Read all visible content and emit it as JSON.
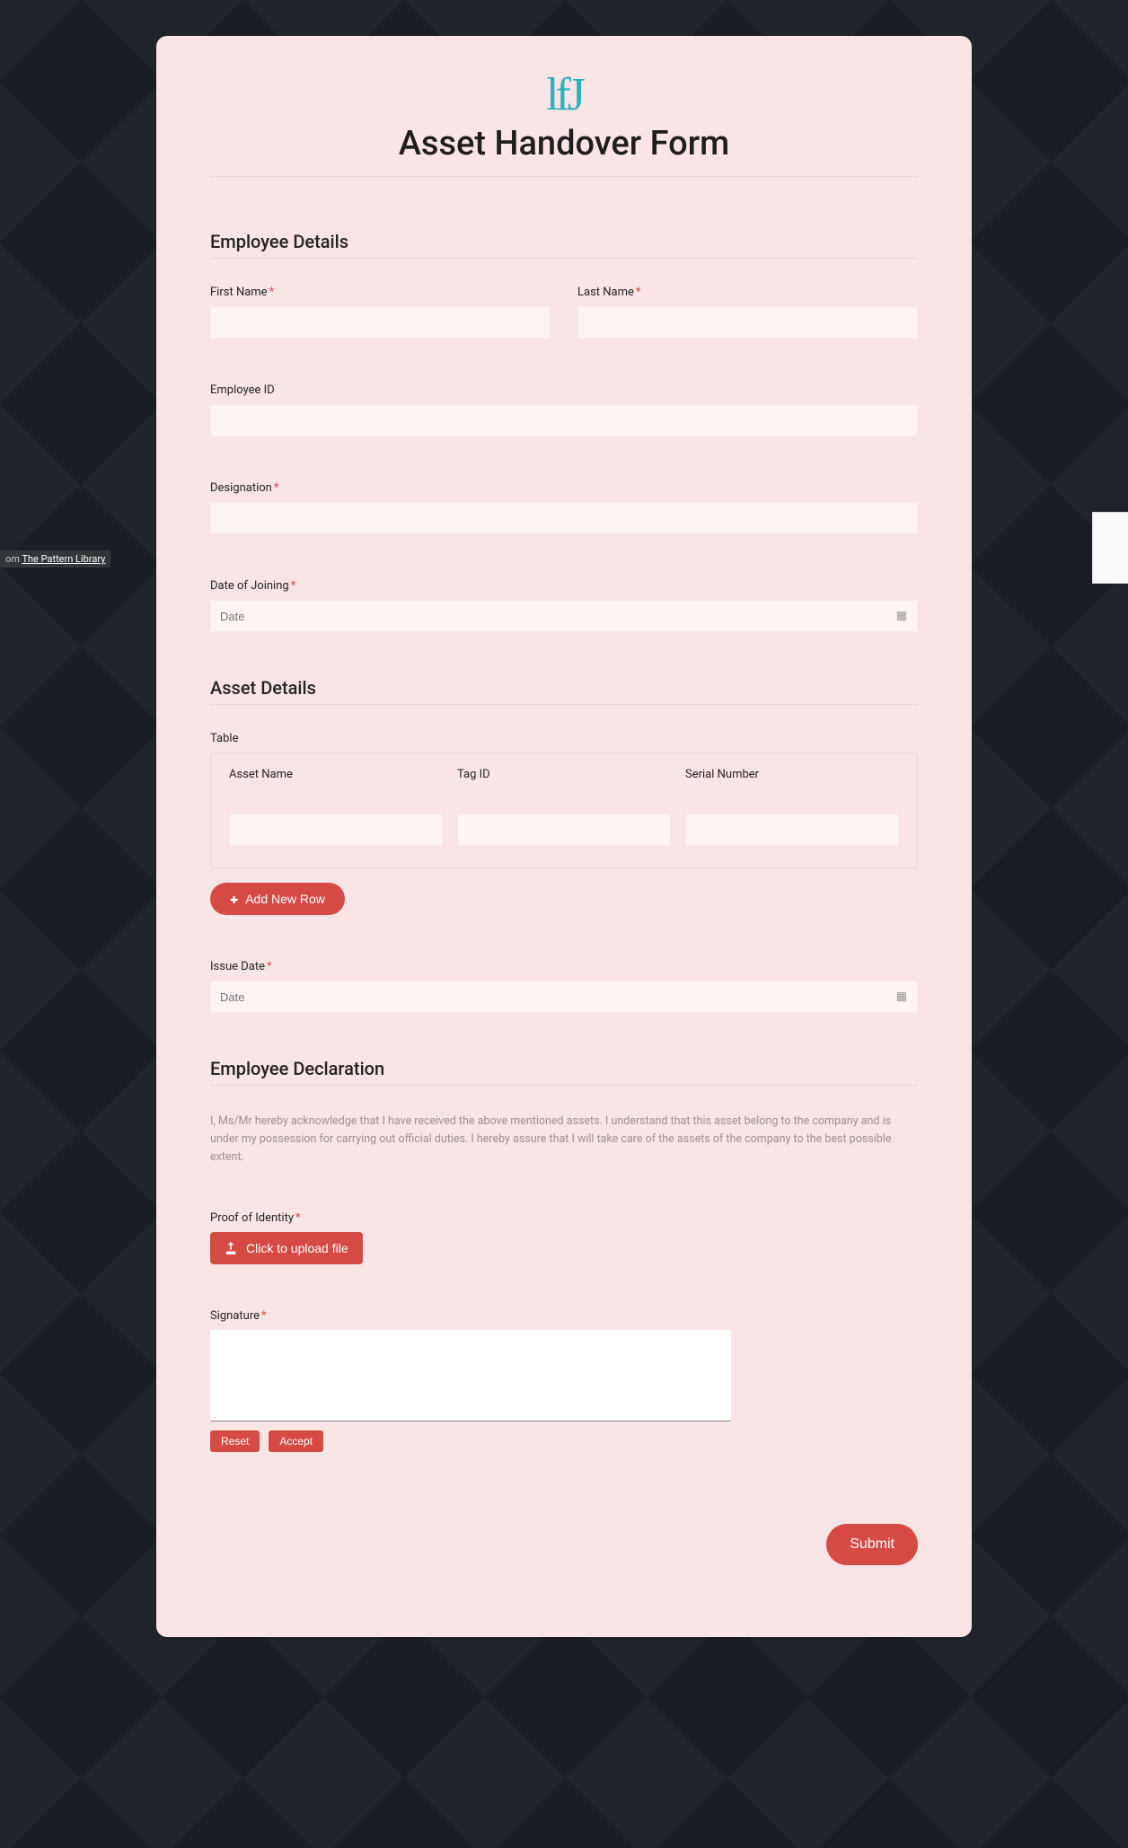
{
  "attribution": {
    "prefix": "om ",
    "link": "The Pattern Library"
  },
  "header": {
    "logo_text": "lfJ",
    "title": "Asset Handover Form"
  },
  "sections": {
    "employee": {
      "title": "Employee Details",
      "first_name_label": "First Name",
      "last_name_label": "Last Name",
      "employee_id_label": "Employee ID",
      "designation_label": "Designation",
      "doj_label": "Date of Joining",
      "date_placeholder": "Date"
    },
    "assets": {
      "title": "Asset Details",
      "table_label": "Table",
      "col1": "Asset Name",
      "col2": "Tag ID",
      "col3": "Serial Number",
      "add_row": "Add New Row",
      "issue_date_label": "Issue Date",
      "date_placeholder": "Date"
    },
    "declaration": {
      "title": "Employee Declaration",
      "text": "I, Ms/Mr hereby acknowledge that I have received the above mentioned assets. I understand that this asset belong to the company and is under my possession for carrying out official duties. I hereby assure that I will take care of the assets of the company to the best possible extent.",
      "proof_label": "Proof of Identity",
      "upload_label": "Click to upload file",
      "signature_label": "Signature",
      "reset": "Reset",
      "accept": "Accept"
    }
  },
  "submit": "Submit"
}
